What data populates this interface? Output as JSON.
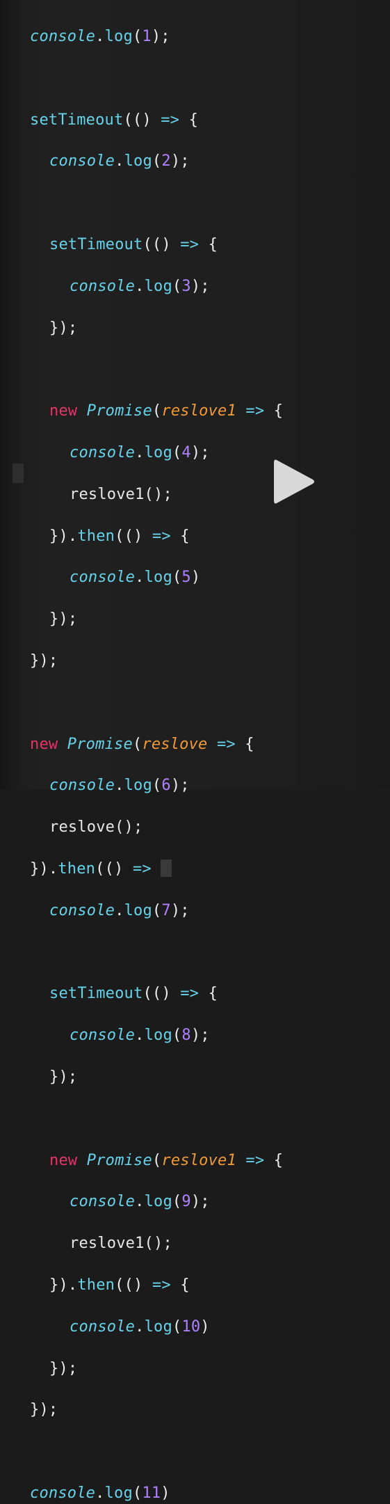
{
  "lines": {
    "l1": {
      "obj": "console",
      "dot": ".",
      "fn": "log",
      "open": "(",
      "num": "1",
      "close": ");"
    },
    "l3": {
      "fn": "setTimeout",
      "open": "(()",
      "arrow": " => ",
      "brace": "{"
    },
    "l4": {
      "obj": "console",
      "dot": ".",
      "fn": "log",
      "open": "(",
      "num": "2",
      "close": ");"
    },
    "l6": {
      "fn": "setTimeout",
      "open": "(()",
      "arrow": " => ",
      "brace": "{"
    },
    "l7": {
      "obj": "console",
      "dot": ".",
      "fn": "log",
      "open": "(",
      "num": "3",
      "close": ");"
    },
    "l8": {
      "text": "});"
    },
    "l10": {
      "kw": "new",
      "cls": "Promise",
      "open": "(",
      "param": "reslove1",
      "arrow": " => ",
      "brace": "{"
    },
    "l11": {
      "obj": "console",
      "dot": ".",
      "fn": "log",
      "open": "(",
      "num": "4",
      "close": ");"
    },
    "l12": {
      "text": "reslove1();"
    },
    "l13": {
      "pre": "}).",
      "fn": "then",
      "open": "(()",
      "arrow": " => ",
      "brace": "{"
    },
    "l14": {
      "obj": "console",
      "dot": ".",
      "fn": "log",
      "open": "(",
      "num": "5",
      "close": ")"
    },
    "l15": {
      "text": "});"
    },
    "l16": {
      "text": "});"
    },
    "l18": {
      "kw": "new",
      "cls": "Promise",
      "open": "(",
      "param": "reslove",
      "arrow": " => ",
      "brace": "{"
    },
    "l19": {
      "obj": "console",
      "dot": ".",
      "fn": "log",
      "open": "(",
      "num": "6",
      "close": ");"
    },
    "l20": {
      "text": "reslove();"
    },
    "l21": {
      "pre": "}).",
      "fn": "then",
      "open": "(()",
      "arrow": " => ",
      "brace": "{"
    },
    "l22": {
      "obj": "console",
      "dot": ".",
      "fn": "log",
      "open": "(",
      "num": "7",
      "close": ");"
    },
    "l24": {
      "fn": "setTimeout",
      "open": "(()",
      "arrow": " => ",
      "brace": "{"
    },
    "l25": {
      "obj": "console",
      "dot": ".",
      "fn": "log",
      "open": "(",
      "num": "8",
      "close": ");"
    },
    "l26": {
      "text": "});"
    },
    "l28": {
      "kw": "new",
      "cls": "Promise",
      "open": "(",
      "param": "reslove1",
      "arrow": " => ",
      "brace": "{"
    },
    "l29": {
      "obj": "console",
      "dot": ".",
      "fn": "log",
      "open": "(",
      "num": "9",
      "close": ");"
    },
    "l30": {
      "text": "reslove1();"
    },
    "l31": {
      "pre": "}).",
      "fn": "then",
      "open": "(()",
      "arrow": " => ",
      "brace": "{"
    },
    "l32": {
      "obj": "console",
      "dot": ".",
      "fn": "log",
      "open": "(",
      "num": "10",
      "close": ")"
    },
    "l33": {
      "text": "});"
    },
    "l34": {
      "text": "});"
    },
    "l36": {
      "obj": "console",
      "dot": ".",
      "fn": "log",
      "open": "(",
      "num": "11",
      "close": ")"
    }
  },
  "icons": {
    "play": "play-icon"
  },
  "colors": {
    "background": "#1e1e1e",
    "function": "#67d3ea",
    "number": "#b081ff",
    "keyword": "#e8336a",
    "parameter": "#f29a36",
    "text": "#e8e8e8",
    "play_button": "#d9d9d9"
  }
}
